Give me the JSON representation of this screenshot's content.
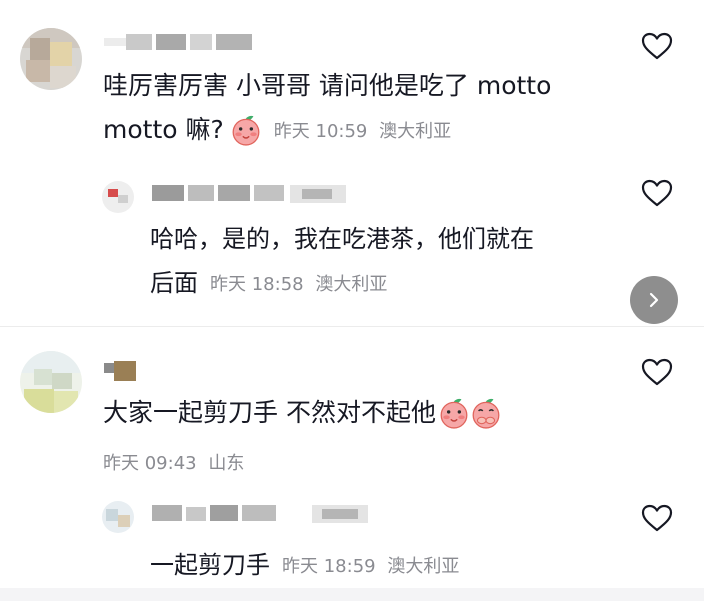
{
  "comments": [
    {
      "text_line1": "哇厉害厉害 小哥哥 请问他是吃了 motto",
      "text_line2": "motto 嘛?",
      "meta": {
        "time": "昨天 10:59",
        "location": "澳大利亚"
      },
      "icons": {
        "like": "heart-outline-icon",
        "sticker": "peach-emoji-icon"
      },
      "reply": {
        "text_line1": "哈哈，是的，我在吃港茶，他们就在",
        "text_line2": "后面",
        "meta": {
          "time": "昨天 18:58",
          "location": "澳大利亚"
        }
      }
    },
    {
      "text": "大家一起剪刀手 不然对不起他",
      "meta": {
        "time": "昨天 09:43",
        "location": "山东"
      },
      "icons": {
        "like": "heart-outline-icon",
        "stickers": [
          "peach-emoji-icon",
          "peach-covering-mouth-emoji-icon"
        ]
      },
      "reply": {
        "text": "一起剪刀手",
        "meta": {
          "time": "昨天 18:59",
          "location": "澳大利亚"
        }
      }
    }
  ],
  "controls": {
    "next_button_icon": "chevron-right-icon"
  },
  "colors": {
    "text": "#161823",
    "meta": "#8a8b91",
    "divider": "#ececec",
    "next_button": "#8e8e8e"
  }
}
